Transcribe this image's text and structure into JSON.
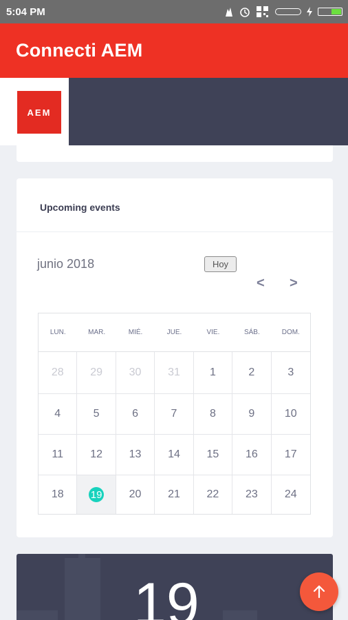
{
  "status_bar": {
    "time": "5:04 PM",
    "icons": [
      "notification-icon",
      "alarm-icon",
      "qr-icon",
      "battery-saver-icon",
      "charging-icon",
      "battery-icon"
    ]
  },
  "app_bar": {
    "title": "Connecti AEM",
    "color": "#ee3124"
  },
  "header": {
    "logo_text": "AEM"
  },
  "events": {
    "title": "Upcoming events",
    "month_label": "junio 2018",
    "today_button": "Hoy",
    "prev_label": "<",
    "next_label": ">",
    "weekdays": [
      "LUN.",
      "MAR.",
      "MIÉ.",
      "JUE.",
      "VIE.",
      "SÁB.",
      "DOM."
    ],
    "weeks": [
      [
        "28",
        "29",
        "30",
        "31",
        "1",
        "2",
        "3"
      ],
      [
        "4",
        "5",
        "6",
        "7",
        "8",
        "9",
        "10"
      ],
      [
        "11",
        "12",
        "13",
        "14",
        "15",
        "16",
        "17"
      ],
      [
        "18",
        "19",
        "20",
        "21",
        "22",
        "23",
        "24"
      ]
    ],
    "today": "19",
    "accent": "#18d2bd"
  },
  "featured": {
    "day": "19"
  },
  "fab": {
    "icon": "arrow-up-icon",
    "color": "#f4583b"
  }
}
